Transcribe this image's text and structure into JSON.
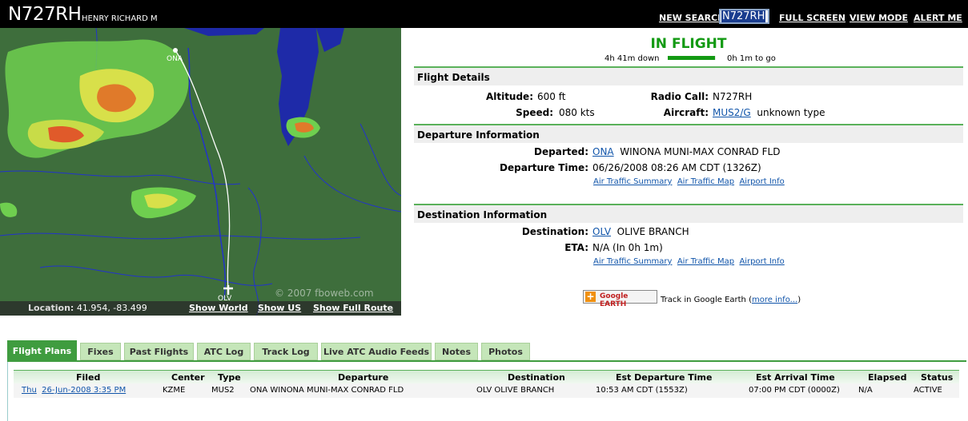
{
  "header": {
    "tail": "N727RH",
    "owner": "HENRY RICHARD M",
    "new_search": "NEW SEARCH",
    "search_value": "N727RH",
    "full_screen": "FULL SCREEN",
    "view_mode": "VIEW MODE",
    "alert_me": "ALERT ME"
  },
  "map": {
    "origin_label": "ONA",
    "dest_label": "OLV",
    "copyright": "© 2007 fboweb.com",
    "location_label": "Location:",
    "location_value": "41.954, -83.499",
    "show_world": "Show World",
    "show_us": "Show US",
    "show_full_route": "Show Full Route"
  },
  "flight": {
    "status": "IN FLIGHT",
    "elapsed": "4h 41m down",
    "remaining": "0h 1m to go",
    "progress": 0.99
  },
  "details": {
    "title": "Flight Details",
    "altitude_label": "Altitude:",
    "altitude_value": "600 ft",
    "speed_label": "Speed:",
    "speed_value": "080  kts",
    "radio_label": "Radio Call:",
    "radio_value": "N727RH",
    "aircraft_label": "Aircraft:",
    "aircraft_code": "MUS2/G",
    "aircraft_type": "unknown type"
  },
  "departure": {
    "title": "Departure Information",
    "departed_label": "Departed:",
    "code": "ONA",
    "name": "WINONA MUNI-MAX CONRAD FLD",
    "time_label": "Departure Time:",
    "time_value": "06/26/2008 08:26 AM CDT (1326Z)",
    "link_summary": "Air Traffic Summary",
    "link_map": "Air Traffic Map",
    "link_info": "Airport Info"
  },
  "destination": {
    "title": "Destination Information",
    "dest_label": "Destination:",
    "code": "OLV",
    "name": "OLIVE BRANCH",
    "eta_label": "ETA:",
    "eta_value": "N/A (In 0h 1m)",
    "link_summary": "Air Traffic Summary",
    "link_map": "Air Traffic Map",
    "link_info": "Airport Info"
  },
  "google_earth": {
    "button": "Google EARTH",
    "text": "Track in Google Earth (",
    "more": "more info...",
    "close": ")"
  },
  "tabs": [
    "Flight Plans",
    "Fixes",
    "Past Flights",
    "ATC Log",
    "Track Log",
    "Live ATC Audio Feeds",
    "Notes",
    "Photos"
  ],
  "table": {
    "headers": [
      "Filed",
      "Center",
      "Type",
      "Departure",
      "Destination",
      "Est Departure Time",
      "Est Arrival Time",
      "Elapsed",
      "Status"
    ],
    "row": {
      "day": "Thu",
      "date": "26-Jun-2008 3:35 PM",
      "center": "KZME",
      "type": "MUS2",
      "departure": "ONA  WINONA MUNI-MAX CONRAD FLD",
      "destination": "OLV  OLIVE BRANCH",
      "est_departure": "10:53 AM CDT (1553Z)",
      "est_arrival": "07:00 PM CDT (0000Z)",
      "elapsed": "N/A",
      "status": "ACTIVE"
    }
  }
}
